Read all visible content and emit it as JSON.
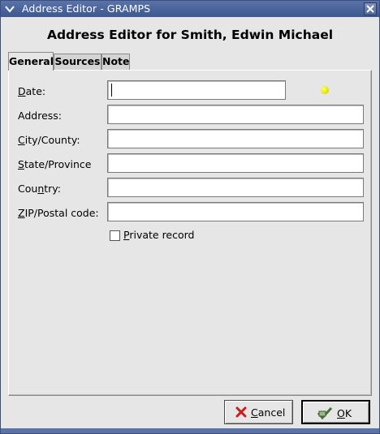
{
  "window": {
    "title": "Address Editor - GRAMPS",
    "heading": "Address Editor for Smith, Edwin Michael"
  },
  "tabs": [
    {
      "label": "General",
      "active": true
    },
    {
      "label": "Sources",
      "active": false
    },
    {
      "label": "Note",
      "active": false
    }
  ],
  "form": {
    "date_label": "Date:",
    "date_value": "",
    "address_label": "Address:",
    "address_value": "",
    "city_label": "City/County:",
    "city_value": "",
    "state_label": "State/Province",
    "state_value": "",
    "country_label": "Country:",
    "country_value": "",
    "zip_label": "ZIP/Postal code:",
    "zip_value": "",
    "private_label": "Private record",
    "private_checked": false
  },
  "buttons": {
    "cancel_label": "Cancel",
    "ok_label": "OK"
  },
  "icons": {
    "window_menu": "chevron-down-icon",
    "close": "close-icon",
    "date_status": "date-validation-led-icon",
    "cancel": "red-x-icon",
    "ok": "ok-check-icon"
  },
  "colors": {
    "titlebar": "#3d5791",
    "background": "#e6e6e6",
    "date_led": "#e6e600"
  }
}
